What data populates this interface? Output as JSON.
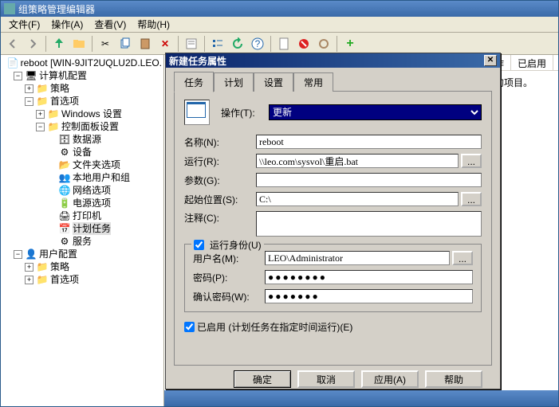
{
  "window": {
    "title": "组策略管理编辑器"
  },
  "menu": {
    "file": "文件(F)",
    "action": "操作(A)",
    "view": "查看(V)",
    "help": "帮助(H)"
  },
  "tree": {
    "root": "reboot [WIN-9JIT2UQLU2D.LEO.",
    "computer_cfg": "计算机配置",
    "policies": "策略",
    "preferences": "首选项",
    "windows_settings": "Windows 设置",
    "cp_settings": "控制面板设置",
    "datasources": "数据源",
    "devices": "设备",
    "folder_options": "文件夹选项",
    "local_users": "本地用户和组",
    "network_options": "网络选项",
    "power_options": "电源选项",
    "printers": "打印机",
    "scheduled_tasks": "计划任务",
    "services": "服务",
    "user_cfg": "用户配置",
    "u_policies": "策略",
    "u_preferences": "首选项"
  },
  "right": {
    "col_action": "操作",
    "col_enabled": "已启用",
    "empty_msg": "显示的项目。"
  },
  "dialog": {
    "title": "新建任务属性",
    "tabs": {
      "task": "任务",
      "schedule": "计划",
      "settings": "设置",
      "common": "常用"
    },
    "fields": {
      "action_lbl": "操作(T):",
      "action_val": "更新",
      "name_lbl": "名称(N):",
      "name_val": "reboot",
      "run_lbl": "运行(R):",
      "run_val": "\\\\leo.com\\sysvol\\重启.bat",
      "args_lbl": "参数(G):",
      "args_val": "",
      "start_lbl": "起始位置(S):",
      "start_val": "C:\\",
      "comment_lbl": "注释(C):",
      "comment_val": ""
    },
    "runas": {
      "legend": "运行身份(U)",
      "checked": true,
      "user_lbl": "用户名(M):",
      "user_val": "LEO\\Administrator",
      "pwd_lbl": "密码(P):",
      "pwd_val": "●●●●●●●●",
      "pwd2_lbl": "确认密码(W):",
      "pwd2_val": "●●●●●●●"
    },
    "enabled": {
      "checked": true,
      "label": "已启用 (计划任务在指定时间运行)(E)"
    },
    "buttons": {
      "ok": "确定",
      "cancel": "取消",
      "apply": "应用(A)",
      "help": "帮助"
    }
  }
}
